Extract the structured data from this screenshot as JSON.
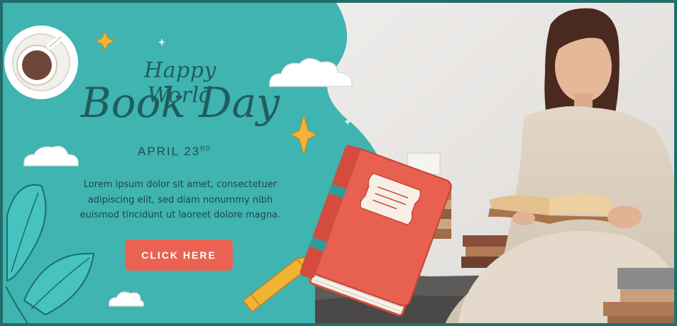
{
  "banner": {
    "title_line1": "Happy World",
    "title_line2": "Book Day",
    "date_text": "APRIL 23",
    "date_suffix": "RD",
    "description": "Lorem ipsum dolor sit amet, consectetuer adipiscing elit, sed diam nonummy nibh euismod tincidunt ut laoreet dolore magna.",
    "cta_label": "CLICK HERE"
  },
  "colors": {
    "teal_background": "#3fb4b1",
    "dark_teal_text": "#1f5e5d",
    "frame_border": "#216e6c",
    "cta_coral": "#ea6352",
    "book_red": "#e8604f",
    "book_spine_teal": "#2f9c9a",
    "pencil_yellow": "#f2b234",
    "sparkle_yellow": "#f5b335",
    "sweater_cream": "#ddd0bf"
  },
  "icons": {
    "coffee": "coffee-cup-icon",
    "book": "red-book-icon",
    "pencil": "pencil-icon",
    "sparkle": "sparkle-icon",
    "cloud": "cloud-icon",
    "leaf": "leaf-icon"
  }
}
